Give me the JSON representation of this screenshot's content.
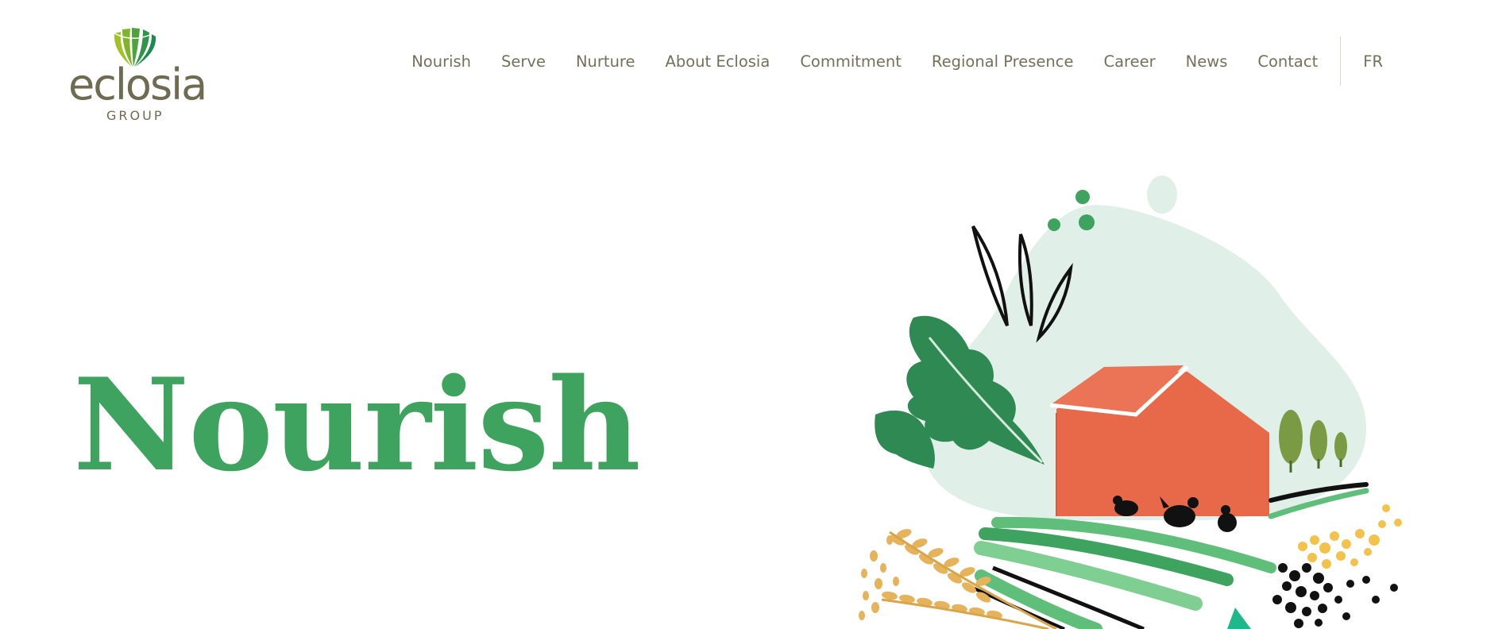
{
  "logo": {
    "word": "eclosia",
    "sub": "GROUP"
  },
  "nav": {
    "items": [
      {
        "label": "Nourish"
      },
      {
        "label": "Serve"
      },
      {
        "label": "Nurture"
      },
      {
        "label": "About Eclosia"
      },
      {
        "label": "Commitment"
      },
      {
        "label": "Regional Presence"
      },
      {
        "label": "Career"
      },
      {
        "label": "News"
      },
      {
        "label": "Contact"
      }
    ],
    "language": "FR"
  },
  "hero": {
    "title": "Nourish"
  },
  "colors": {
    "brand_green": "#3ea35e",
    "text_olive": "#74705a",
    "barn_red": "#e8694a",
    "bell_mint": "#e0efe7"
  }
}
